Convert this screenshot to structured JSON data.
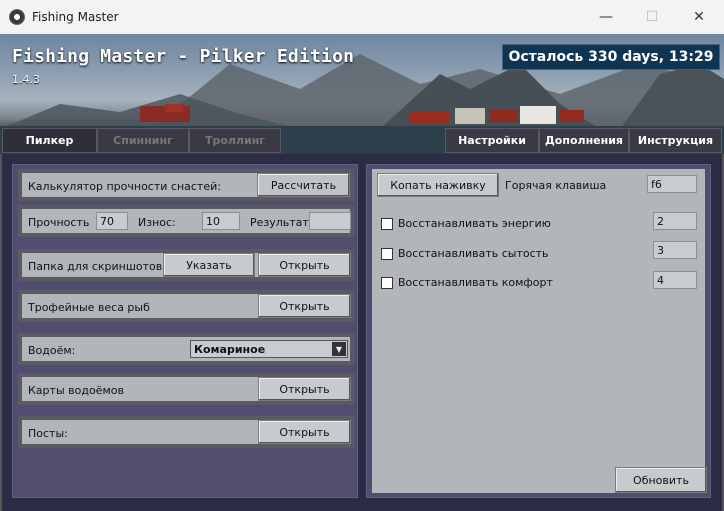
{
  "window": {
    "title": "Fishing Master",
    "controls": {
      "minimize": "—",
      "maximize": "☐",
      "close": "✕"
    }
  },
  "banner": {
    "title": "Fishing Master - Pilker Edition",
    "version": "1.4.3",
    "remaining": "Осталось 330 days, 13:29"
  },
  "tabs": {
    "left": [
      {
        "label": "Пилкер",
        "state": "active"
      },
      {
        "label": "Спиннинг",
        "state": "disabled"
      },
      {
        "label": "Троллинг",
        "state": "disabled"
      }
    ],
    "right": [
      {
        "label": "Настройки"
      },
      {
        "label": "Дополнения"
      },
      {
        "label": "Инструкция"
      }
    ]
  },
  "left_panel": {
    "calculator": {
      "label": "Калькулятор прочности снастей:",
      "button": "Рассчитать"
    },
    "strength": {
      "strength_label": "Прочность",
      "strength_value": "70",
      "wear_label": "Износ:",
      "wear_value": "10",
      "result_label": "Результат:",
      "result_value": ""
    },
    "screenshots": {
      "label": "Папка для скриншотов:",
      "choose_button": "Указать",
      "open_button": "Открыть"
    },
    "trophy": {
      "label": "Трофейные веса рыб",
      "open_button": "Открыть"
    },
    "water": {
      "label": "Водоём:",
      "selected": "Комариное"
    },
    "maps": {
      "label": "Карты водоёмов",
      "open_button": "Открыть"
    },
    "posts": {
      "label": "Посты:",
      "open_button": "Открыть"
    }
  },
  "right_panel": {
    "dig_button": "Копать наживку",
    "hotkey_label": "Горячая клавиша",
    "hotkey_value": "f6",
    "options": [
      {
        "label": "Восстанавливать энергию",
        "value": "2",
        "checked": false
      },
      {
        "label": "Восстанавливать сытость",
        "value": "3",
        "checked": false
      },
      {
        "label": "Восстанавливать комфорт",
        "value": "4",
        "checked": false
      }
    ],
    "refresh_button": "Обновить"
  },
  "colors": {
    "panel_bg": "#504d6e",
    "row_bg": "#b2b6bb",
    "remaining_bg": "#0f3553",
    "tab_bg": "#3a3a44"
  }
}
